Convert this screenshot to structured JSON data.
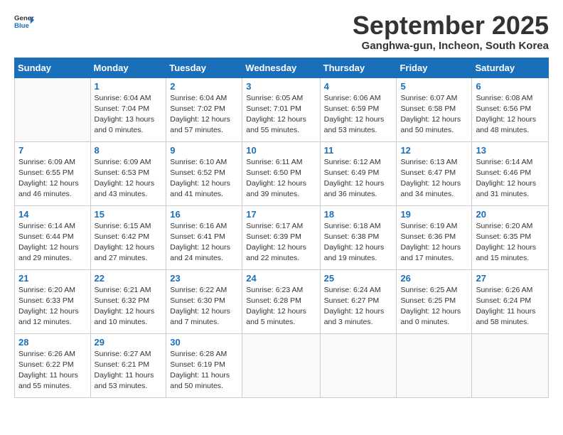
{
  "header": {
    "logo_general": "General",
    "logo_blue": "Blue",
    "month_title": "September 2025",
    "location": "Ganghwa-gun, Incheon, South Korea"
  },
  "weekdays": [
    "Sunday",
    "Monday",
    "Tuesday",
    "Wednesday",
    "Thursday",
    "Friday",
    "Saturday"
  ],
  "weeks": [
    [
      {
        "day": "",
        "sunrise": "",
        "sunset": "",
        "daylight": ""
      },
      {
        "day": "1",
        "sunrise": "Sunrise: 6:04 AM",
        "sunset": "Sunset: 7:04 PM",
        "daylight": "Daylight: 13 hours and 0 minutes."
      },
      {
        "day": "2",
        "sunrise": "Sunrise: 6:04 AM",
        "sunset": "Sunset: 7:02 PM",
        "daylight": "Daylight: 12 hours and 57 minutes."
      },
      {
        "day": "3",
        "sunrise": "Sunrise: 6:05 AM",
        "sunset": "Sunset: 7:01 PM",
        "daylight": "Daylight: 12 hours and 55 minutes."
      },
      {
        "day": "4",
        "sunrise": "Sunrise: 6:06 AM",
        "sunset": "Sunset: 6:59 PM",
        "daylight": "Daylight: 12 hours and 53 minutes."
      },
      {
        "day": "5",
        "sunrise": "Sunrise: 6:07 AM",
        "sunset": "Sunset: 6:58 PM",
        "daylight": "Daylight: 12 hours and 50 minutes."
      },
      {
        "day": "6",
        "sunrise": "Sunrise: 6:08 AM",
        "sunset": "Sunset: 6:56 PM",
        "daylight": "Daylight: 12 hours and 48 minutes."
      }
    ],
    [
      {
        "day": "7",
        "sunrise": "Sunrise: 6:09 AM",
        "sunset": "Sunset: 6:55 PM",
        "daylight": "Daylight: 12 hours and 46 minutes."
      },
      {
        "day": "8",
        "sunrise": "Sunrise: 6:09 AM",
        "sunset": "Sunset: 6:53 PM",
        "daylight": "Daylight: 12 hours and 43 minutes."
      },
      {
        "day": "9",
        "sunrise": "Sunrise: 6:10 AM",
        "sunset": "Sunset: 6:52 PM",
        "daylight": "Daylight: 12 hours and 41 minutes."
      },
      {
        "day": "10",
        "sunrise": "Sunrise: 6:11 AM",
        "sunset": "Sunset: 6:50 PM",
        "daylight": "Daylight: 12 hours and 39 minutes."
      },
      {
        "day": "11",
        "sunrise": "Sunrise: 6:12 AM",
        "sunset": "Sunset: 6:49 PM",
        "daylight": "Daylight: 12 hours and 36 minutes."
      },
      {
        "day": "12",
        "sunrise": "Sunrise: 6:13 AM",
        "sunset": "Sunset: 6:47 PM",
        "daylight": "Daylight: 12 hours and 34 minutes."
      },
      {
        "day": "13",
        "sunrise": "Sunrise: 6:14 AM",
        "sunset": "Sunset: 6:46 PM",
        "daylight": "Daylight: 12 hours and 31 minutes."
      }
    ],
    [
      {
        "day": "14",
        "sunrise": "Sunrise: 6:14 AM",
        "sunset": "Sunset: 6:44 PM",
        "daylight": "Daylight: 12 hours and 29 minutes."
      },
      {
        "day": "15",
        "sunrise": "Sunrise: 6:15 AM",
        "sunset": "Sunset: 6:42 PM",
        "daylight": "Daylight: 12 hours and 27 minutes."
      },
      {
        "day": "16",
        "sunrise": "Sunrise: 6:16 AM",
        "sunset": "Sunset: 6:41 PM",
        "daylight": "Daylight: 12 hours and 24 minutes."
      },
      {
        "day": "17",
        "sunrise": "Sunrise: 6:17 AM",
        "sunset": "Sunset: 6:39 PM",
        "daylight": "Daylight: 12 hours and 22 minutes."
      },
      {
        "day": "18",
        "sunrise": "Sunrise: 6:18 AM",
        "sunset": "Sunset: 6:38 PM",
        "daylight": "Daylight: 12 hours and 19 minutes."
      },
      {
        "day": "19",
        "sunrise": "Sunrise: 6:19 AM",
        "sunset": "Sunset: 6:36 PM",
        "daylight": "Daylight: 12 hours and 17 minutes."
      },
      {
        "day": "20",
        "sunrise": "Sunrise: 6:20 AM",
        "sunset": "Sunset: 6:35 PM",
        "daylight": "Daylight: 12 hours and 15 minutes."
      }
    ],
    [
      {
        "day": "21",
        "sunrise": "Sunrise: 6:20 AM",
        "sunset": "Sunset: 6:33 PM",
        "daylight": "Daylight: 12 hours and 12 minutes."
      },
      {
        "day": "22",
        "sunrise": "Sunrise: 6:21 AM",
        "sunset": "Sunset: 6:32 PM",
        "daylight": "Daylight: 12 hours and 10 minutes."
      },
      {
        "day": "23",
        "sunrise": "Sunrise: 6:22 AM",
        "sunset": "Sunset: 6:30 PM",
        "daylight": "Daylight: 12 hours and 7 minutes."
      },
      {
        "day": "24",
        "sunrise": "Sunrise: 6:23 AM",
        "sunset": "Sunset: 6:28 PM",
        "daylight": "Daylight: 12 hours and 5 minutes."
      },
      {
        "day": "25",
        "sunrise": "Sunrise: 6:24 AM",
        "sunset": "Sunset: 6:27 PM",
        "daylight": "Daylight: 12 hours and 3 minutes."
      },
      {
        "day": "26",
        "sunrise": "Sunrise: 6:25 AM",
        "sunset": "Sunset: 6:25 PM",
        "daylight": "Daylight: 12 hours and 0 minutes."
      },
      {
        "day": "27",
        "sunrise": "Sunrise: 6:26 AM",
        "sunset": "Sunset: 6:24 PM",
        "daylight": "Daylight: 11 hours and 58 minutes."
      }
    ],
    [
      {
        "day": "28",
        "sunrise": "Sunrise: 6:26 AM",
        "sunset": "Sunset: 6:22 PM",
        "daylight": "Daylight: 11 hours and 55 minutes."
      },
      {
        "day": "29",
        "sunrise": "Sunrise: 6:27 AM",
        "sunset": "Sunset: 6:21 PM",
        "daylight": "Daylight: 11 hours and 53 minutes."
      },
      {
        "day": "30",
        "sunrise": "Sunrise: 6:28 AM",
        "sunset": "Sunset: 6:19 PM",
        "daylight": "Daylight: 11 hours and 50 minutes."
      },
      {
        "day": "",
        "sunrise": "",
        "sunset": "",
        "daylight": ""
      },
      {
        "day": "",
        "sunrise": "",
        "sunset": "",
        "daylight": ""
      },
      {
        "day": "",
        "sunrise": "",
        "sunset": "",
        "daylight": ""
      },
      {
        "day": "",
        "sunrise": "",
        "sunset": "",
        "daylight": ""
      }
    ]
  ]
}
